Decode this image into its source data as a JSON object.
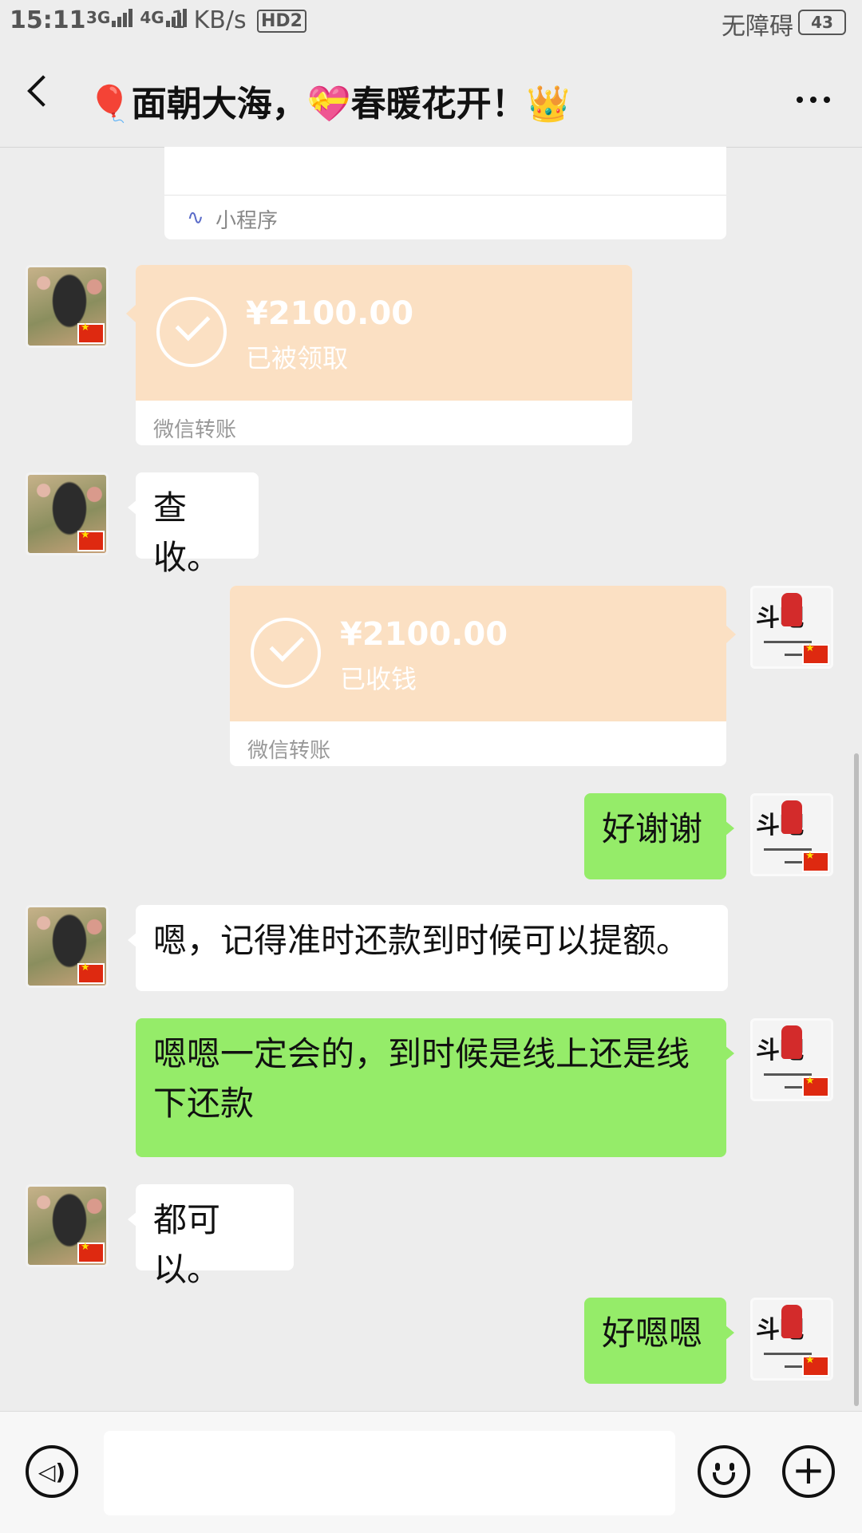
{
  "status_bar": {
    "time": "15:11",
    "network_a": "3G",
    "network_b": "4G",
    "speed": "1 KB/s",
    "hd": "HD2",
    "accessibility": "无障碍",
    "battery": "43"
  },
  "header": {
    "title": "🎈面朝大海，💝春暖花开！👑"
  },
  "mini_program": {
    "label": "小程序"
  },
  "messages": [
    {
      "side": "left",
      "type": "transfer",
      "amount": "¥2100.00",
      "status": "已被领取",
      "footer": "微信转账"
    },
    {
      "side": "left",
      "type": "text",
      "text": "查收。"
    },
    {
      "side": "right",
      "type": "transfer",
      "amount": "¥2100.00",
      "status": "已收钱",
      "footer": "微信转账"
    },
    {
      "side": "right",
      "type": "text",
      "text": "好谢谢"
    },
    {
      "side": "left",
      "type": "text",
      "text": "嗯，记得准时还款到时候可以提额。"
    },
    {
      "side": "right",
      "type": "text",
      "text": "嗯嗯一定会的，到时候是线上还是线下还款"
    },
    {
      "side": "left",
      "type": "text",
      "text": "都可以。"
    },
    {
      "side": "right",
      "type": "text",
      "text": "好嗯嗯"
    }
  ],
  "avatar_me": {
    "glyph": "斗吧"
  },
  "colors": {
    "green_bubble": "#95ec69",
    "transfer_orange": "#fbe0c3",
    "background": "#ededed"
  },
  "icons": {
    "back": "chevron-left-icon",
    "more": "more-dots-icon",
    "voice": "voice-icon",
    "emoji": "emoji-icon",
    "plus": "plus-icon",
    "mini_program": "mini-program-icon"
  }
}
